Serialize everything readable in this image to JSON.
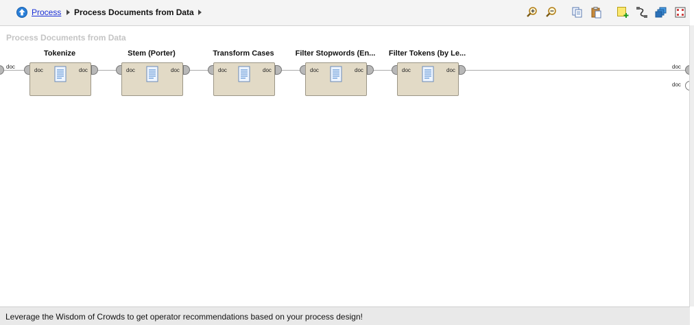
{
  "breadcrumb": {
    "parent_label": "Process",
    "current_label": "Process Documents from Data"
  },
  "toolbar": {
    "icons": [
      "zoom-in-icon",
      "zoom-out-icon",
      "copy-icon",
      "paste-icon",
      "add-note-icon",
      "auto-wire-icon",
      "layers-icon",
      "arrange-icon"
    ]
  },
  "canvas": {
    "process_title": "Process Documents from Data",
    "input_port_label": "doc",
    "output_port_labels": [
      "doc",
      "doc"
    ],
    "operators": [
      {
        "name": "Tokenize",
        "in_port": "doc",
        "out_port": "doc"
      },
      {
        "name": "Stem (Porter)",
        "in_port": "doc",
        "out_port": "doc"
      },
      {
        "name": "Transform Cases",
        "in_port": "doc",
        "out_port": "doc"
      },
      {
        "name": "Filter Stopwords (En...",
        "in_port": "doc",
        "out_port": "doc"
      },
      {
        "name": "Filter Tokens (by Le...",
        "in_port": "doc",
        "out_port": "doc"
      }
    ]
  },
  "status": {
    "message": "Leverage the Wisdom of Crowds to get operator recommendations based on your process design!"
  },
  "colors": {
    "operator_fill": "#e2dac6",
    "link": "#1a2fd6",
    "title_gray": "#c4c4c4"
  }
}
